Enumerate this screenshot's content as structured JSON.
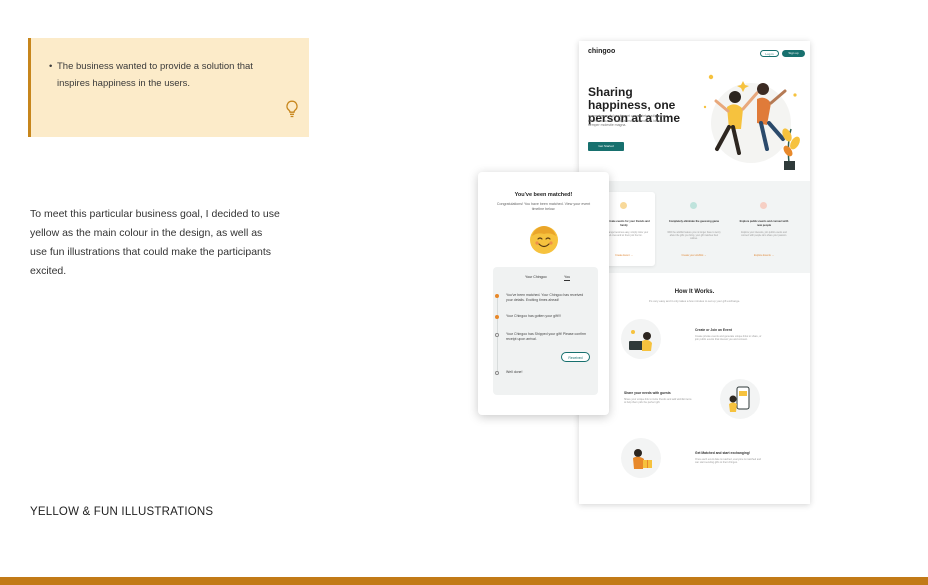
{
  "callout": {
    "text": "The business wanted to provide a solution that inspires happiness in the users.",
    "icon": "lightbulb-icon"
  },
  "body_paragraph": "To meet this particular business goal, I decided to use yellow as the main colour in the design, as well as use fun illustrations that could make the participants excited.",
  "caption": "YELLOW & FUN ILLUSTRATIONS",
  "colors": {
    "callout_bg": "#fcebc9",
    "callout_border": "#c7861c",
    "bottom_bar": "#c27a17",
    "brand_teal": "#17706e",
    "accent_orange": "#e8892b",
    "yellow": "#f6c23e"
  },
  "landing": {
    "logo": "chingoo",
    "nav": {
      "login": "Log in",
      "signup": "Sign up"
    },
    "hero_title": "Sharing happiness, one person at a time",
    "hero_sub": "Lorem ipsum dolor sit amet consectetur adipiscing elit. Nunc auctor volutpat morbi blandit mi id iaculis semper molestie magna.",
    "hero_cta": "Get Started",
    "features": [
      {
        "title": "Create private events for your friends and family",
        "desc": "Gift exchange becomes easy, simply invite your loved ones and let them join the fun.",
        "link": "Create Event →"
      },
      {
        "title": "Completely eliminate the guessing game",
        "desc": "With the wishlist feature you no longer have to worry about the gifts you bring, your gift matches their wishes.",
        "link": "Create your wishlist →"
      },
      {
        "title": "Explore public events and connect with new people",
        "desc": "Explore your interests, join public events and connect with people who share your passion.",
        "link": "Explore Events →"
      }
    ],
    "how_title": "How It Works.",
    "how_sub": "It's very easy and it only takes a few minutes to set up your gift exchange.",
    "steps": [
      {
        "title": "Create or Join an Event",
        "desc": "Create private events and generate unique links to share, or join public events that interest you and connect."
      },
      {
        "title": "Share your needs with guests",
        "desc": "Share your unique link to invite friends and add wishlist items to help them pick the perfect gift."
      },
      {
        "title": "Get Matched and start exchanging!",
        "desc": "Once each event date is reached, everyone is matched and can start sending gifts to their chingoo."
      }
    ]
  },
  "modal": {
    "title": "You've been matched!",
    "subtitle": "Congratulations! You have been matched. View your event timeline below.",
    "tabs": [
      "Your Chingoo",
      "You"
    ],
    "events": [
      {
        "text": "You've been matched. Your Chingoo has received your details. Exciting times ahead!",
        "status": "done"
      },
      {
        "text": "Your Chingoo has gotten your gift!!!",
        "status": "done"
      },
      {
        "text": "Your Chingoo has Shipped your gift! Please confirm receipt upon arrival.",
        "status": "todo"
      },
      {
        "text": "Well done!",
        "status": "todo"
      }
    ],
    "received_button": "Received"
  }
}
